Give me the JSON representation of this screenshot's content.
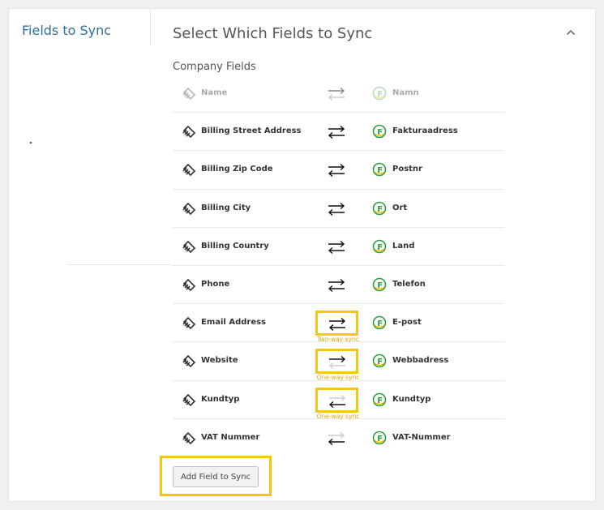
{
  "nav": {
    "fields_to_sync": "Fields to Sync"
  },
  "section": {
    "title": "Select Which Fields to Sync",
    "subtitle": "Company Fields",
    "collapse_icon": "chevron-up-icon"
  },
  "rows": [
    {
      "hubspot": "Name",
      "fortnox": "Namn",
      "sync": "one-way-right",
      "dimmed": true,
      "caption": ""
    },
    {
      "hubspot": "Billing Street Address",
      "fortnox": "Fakturaadress",
      "sync": "two-way",
      "dimmed": false,
      "caption": ""
    },
    {
      "hubspot": "Billing Zip Code",
      "fortnox": "Postnr",
      "sync": "two-way",
      "dimmed": false,
      "caption": ""
    },
    {
      "hubspot": "Billing City",
      "fortnox": "Ort",
      "sync": "two-way",
      "dimmed": false,
      "caption": ""
    },
    {
      "hubspot": "Billing Country",
      "fortnox": "Land",
      "sync": "two-way",
      "dimmed": false,
      "caption": ""
    },
    {
      "hubspot": "Phone",
      "fortnox": "Telefon",
      "sync": "two-way",
      "dimmed": false,
      "caption": ""
    },
    {
      "hubspot": "Email Address",
      "fortnox": "E-post",
      "sync": "two-way",
      "dimmed": false,
      "caption": "Two-way sync",
      "highlight": true
    },
    {
      "hubspot": "Website",
      "fortnox": "Webbadress",
      "sync": "one-way-right",
      "dimmed": false,
      "caption": "One-way sync",
      "highlight": true
    },
    {
      "hubspot": "Kundtyp",
      "fortnox": "Kundtyp",
      "sync": "one-way-left",
      "dimmed": false,
      "caption": "One-way sync",
      "highlight": true
    },
    {
      "hubspot": "VAT Nummer",
      "fortnox": "VAT-Nummer",
      "sync": "one-way-left",
      "dimmed": false,
      "caption": ""
    }
  ],
  "add_button": {
    "label": "Add Field to Sync"
  },
  "colors": {
    "highlight": "#f5c518",
    "link": "#2f6e9a",
    "fortnox_green": "#2e9e3f",
    "fortnox_yellow": "#f2c200"
  }
}
